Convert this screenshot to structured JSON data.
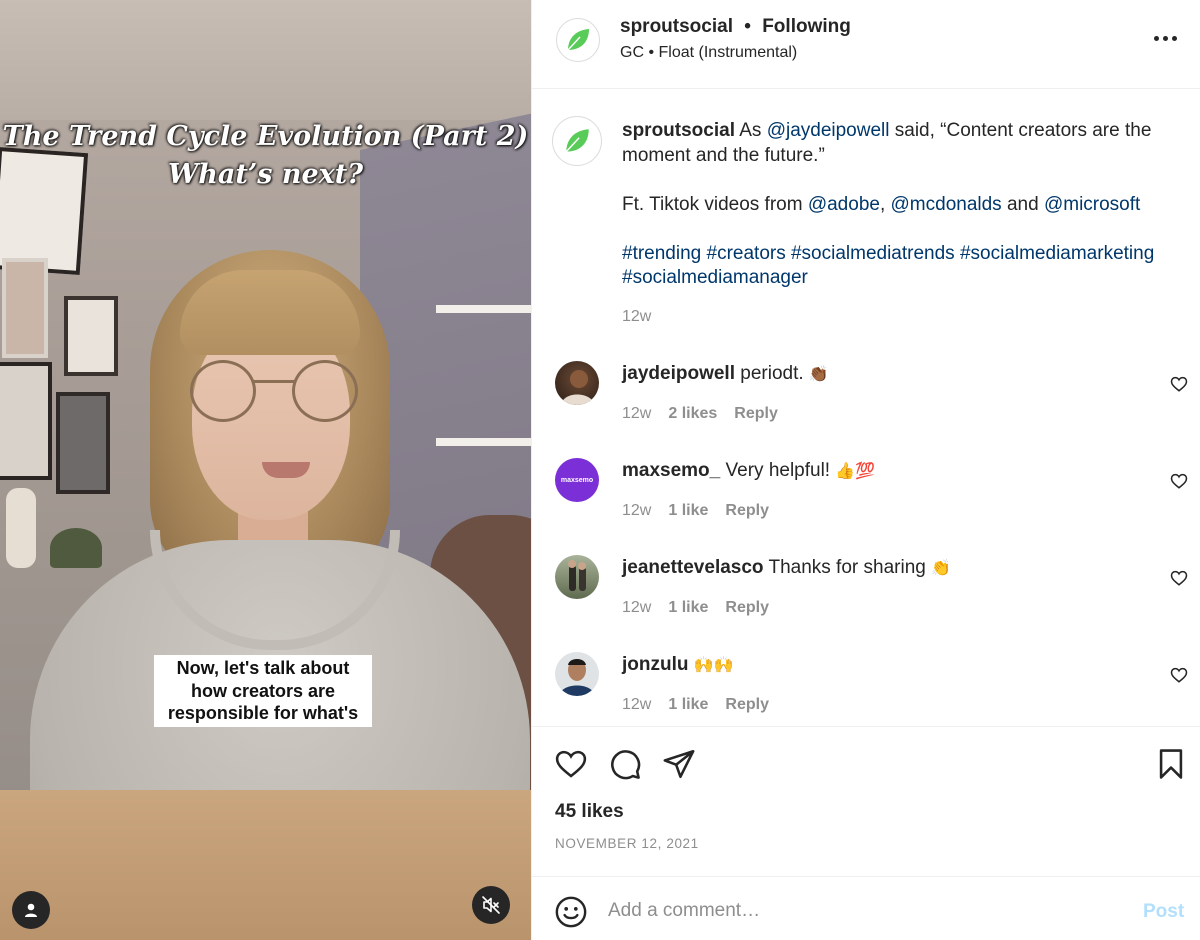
{
  "video": {
    "title_line1": "The Trend Cycle Evolution (Part 2)",
    "title_line2": "What’s next?",
    "caption_line1": "Now, let's talk about",
    "caption_line2": "how creators are",
    "caption_line3": "responsible for what's",
    "user_button_icon": "user-icon",
    "mute_button_icon": "muted-speaker-icon"
  },
  "header": {
    "username": "sproutsocial",
    "separator": "•",
    "follow_status": "Following",
    "audio_artist": "GC",
    "audio_dot": "•",
    "audio_track": "Float (Instrumental)",
    "more_icon": "more-options-icon",
    "brand_color": "#59cb59"
  },
  "caption": {
    "username": "sproutsocial",
    "text_before_mention": "As",
    "mention_1": "@jaydeipowell",
    "text_after_mention": "said, “Content creators are the moment and the future.”",
    "ft_text": "Ft. Tiktok videos from",
    "mention_2": "@adobe",
    "comma": ",",
    "mention_3": "@mcdonalds",
    "and_text": "and",
    "mention_4": "@microsoft",
    "hashtags_line1": "#trending #creators #socialmediatrends #socialmediamarketing",
    "hashtags_line2": "#socialmediamanager",
    "time": "12w",
    "link_color": "#00376b"
  },
  "comments": [
    {
      "username": "jaydeipowell",
      "text": "periodt.",
      "emoji": "👏🏾",
      "time": "12w",
      "likes": "2 likes",
      "reply": "Reply"
    },
    {
      "username": "maxsemo_",
      "text": "Very helpful!",
      "emoji": "👍💯",
      "time": "12w",
      "likes": "1 like",
      "reply": "Reply",
      "avatar_label": "maxsemo"
    },
    {
      "username": "jeanettevelasco",
      "text": "Thanks for sharing",
      "emoji": "👏",
      "time": "12w",
      "likes": "1 like",
      "reply": "Reply"
    },
    {
      "username": "jonzulu",
      "text": "",
      "emoji": "🙌🙌",
      "time": "12w",
      "likes": "1 like",
      "reply": "Reply"
    }
  ],
  "actions": {
    "like_icon": "heart-icon",
    "comment_icon": "comment-icon",
    "share_icon": "share-icon",
    "save_icon": "bookmark-icon",
    "likes": "45 likes",
    "date": "NOVEMBER 12, 2021"
  },
  "add_comment": {
    "emoji_icon": "smiley-icon",
    "placeholder": "Add a comment…",
    "post_label": "Post"
  }
}
